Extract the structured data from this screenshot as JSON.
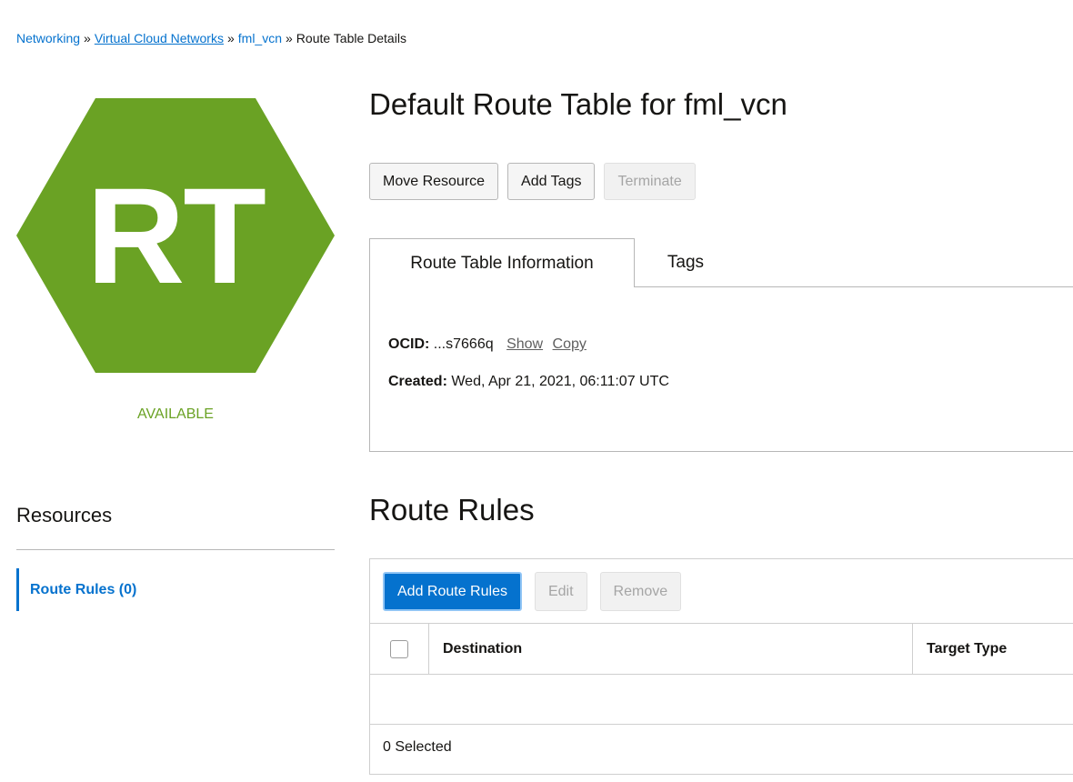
{
  "breadcrumb": {
    "items": [
      "Networking",
      "Virtual Cloud Networks",
      "fml_vcn",
      "Route Table Details"
    ],
    "separator": "»"
  },
  "resource_icon": {
    "text": "RT",
    "color": "#6aa224",
    "status": "AVAILABLE",
    "status_color": "#6aa224"
  },
  "page": {
    "title": "Default Route Table for fml_vcn"
  },
  "actions": {
    "move": "Move Resource",
    "add_tags": "Add Tags",
    "terminate": "Terminate"
  },
  "tabs": [
    {
      "label": "Route Table Information",
      "active": true
    },
    {
      "label": "Tags",
      "active": false
    }
  ],
  "info": {
    "ocid_label": "OCID:",
    "ocid_value": "...s7666q",
    "show": "Show",
    "copy": "Copy",
    "created_label": "Created:",
    "created_value": "Wed, Apr 21, 2021, 06:11:07 UTC"
  },
  "resources": {
    "title": "Resources",
    "items": [
      {
        "label": "Route Rules (0)"
      }
    ]
  },
  "route_rules": {
    "title": "Route Rules",
    "add": "Add Route Rules",
    "edit": "Edit",
    "remove": "Remove",
    "columns": [
      "Destination",
      "Target Type"
    ],
    "rows": [],
    "selected": "0 Selected"
  },
  "colors": {
    "accent": "#0572ce",
    "available": "#6aa224"
  }
}
